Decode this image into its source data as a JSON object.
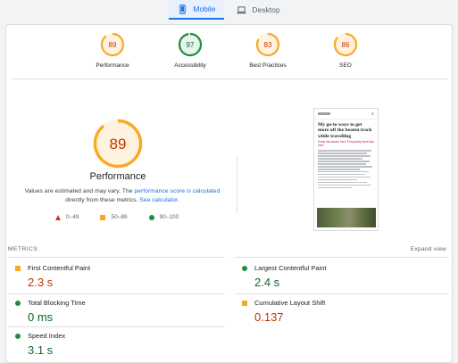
{
  "tabs": [
    {
      "label": "Mobile",
      "icon": "smartphone-icon",
      "active": true
    },
    {
      "label": "Desktop",
      "icon": "laptop-icon",
      "active": false
    }
  ],
  "scores": [
    {
      "label": "Performance",
      "score": "89",
      "value": 89,
      "status": "average"
    },
    {
      "label": "Accessibility",
      "score": "97",
      "value": 97,
      "status": "pass"
    },
    {
      "label": "Best Practices",
      "score": "83",
      "value": 83,
      "status": "average"
    },
    {
      "label": "SEO",
      "score": "86",
      "value": 86,
      "status": "average"
    }
  ],
  "colors": {
    "average": "#f9a825",
    "average_text": "#c33300",
    "average_bg": "#fff3e0",
    "pass": "#1e8e3e",
    "pass_text": "#0d652d",
    "pass_bg": "#e6f4ea",
    "fail": "#d93025",
    "link": "#1a73e8"
  },
  "performance": {
    "score": "89",
    "value": 89,
    "title": "Performance",
    "note_1": "Values are estimated and may vary. The ",
    "note_link_1": "performance score is calculated",
    "note_2": " directly from these metrics. ",
    "note_link_2": "See calculator."
  },
  "legend": [
    {
      "range": "0–49",
      "shape": "triangle"
    },
    {
      "range": "50–89",
      "shape": "square"
    },
    {
      "range": "90–100",
      "shape": "circle"
    }
  ],
  "preview": {
    "headline": "My go-to ways to get more off the beaten track while travelling",
    "subline": "Some discussion here \"Frequently travel tips here\""
  },
  "metrics": {
    "label": "METRICS",
    "expand": "Expand view",
    "items": [
      {
        "name": "First Contentful Paint",
        "value": "2.3 s",
        "status": "average"
      },
      {
        "name": "Largest Contentful Paint",
        "value": "2.4 s",
        "status": "pass"
      },
      {
        "name": "Total Blocking Time",
        "value": "0 ms",
        "status": "pass"
      },
      {
        "name": "Cumulative Layout Shift",
        "value": "0.137",
        "status": "average"
      },
      {
        "name": "Speed Index",
        "value": "3.1 s",
        "status": "pass"
      }
    ]
  }
}
